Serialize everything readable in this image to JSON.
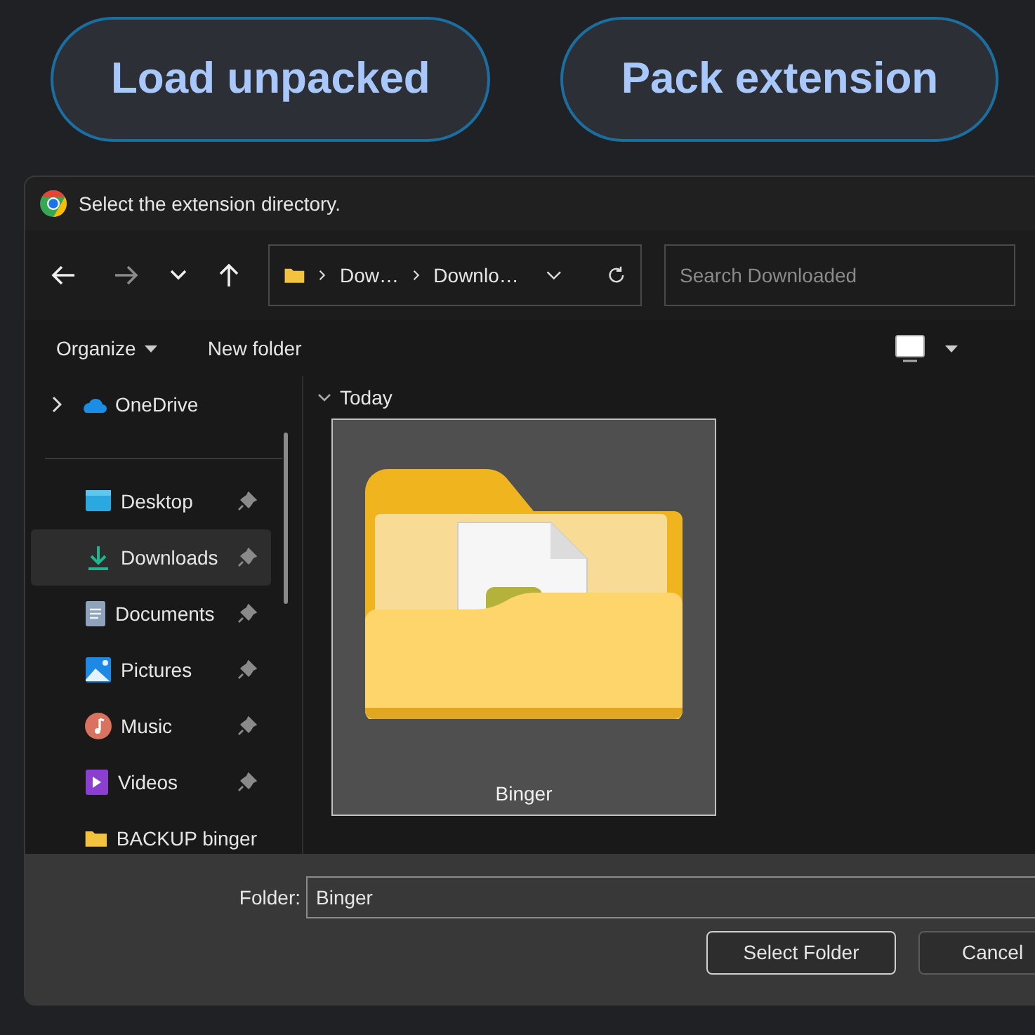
{
  "header": {
    "buttons": [
      "Load unpacked",
      "Pack extension"
    ]
  },
  "dialog": {
    "title": "Select the extension directory.",
    "toolbar": {
      "breadcrumb": [
        "Dow…",
        "Downlo…"
      ],
      "search": {
        "placeholder": "Search Downloaded"
      }
    },
    "commands": [
      {
        "label": "Organize",
        "kind": "menu"
      },
      {
        "label": "New folder",
        "kind": "plain"
      }
    ],
    "sidebar": {
      "items": [
        {
          "label": "OneDrive",
          "kind": "onedrive",
          "expanded": false
        },
        {
          "label": "Desktop",
          "kind": "desktop",
          "pinned": true,
          "selected": false
        },
        {
          "label": "Downloads",
          "kind": "downloads",
          "pinned": true,
          "selected": true
        },
        {
          "label": "Documents",
          "kind": "documents",
          "pinned": true,
          "selected": false
        },
        {
          "label": "Pictures",
          "kind": "pictures",
          "pinned": true,
          "selected": false
        },
        {
          "label": "Music",
          "kind": "music",
          "pinned": true,
          "selected": false
        },
        {
          "label": "Videos",
          "kind": "videos",
          "pinned": true,
          "selected": false
        },
        {
          "label": "BACKUP binger",
          "kind": "folder",
          "pinned": false,
          "selected": false
        }
      ]
    },
    "groups": [
      {
        "label": "Today",
        "expanded": true,
        "items": [
          {
            "name": "Binger",
            "selected": true
          }
        ]
      }
    ],
    "folder_field": {
      "label": "Folder:",
      "value": "Binger"
    },
    "buttons": [
      {
        "label": "Select Folder",
        "default": true
      },
      {
        "label": "Cancel",
        "default": false
      }
    ]
  }
}
